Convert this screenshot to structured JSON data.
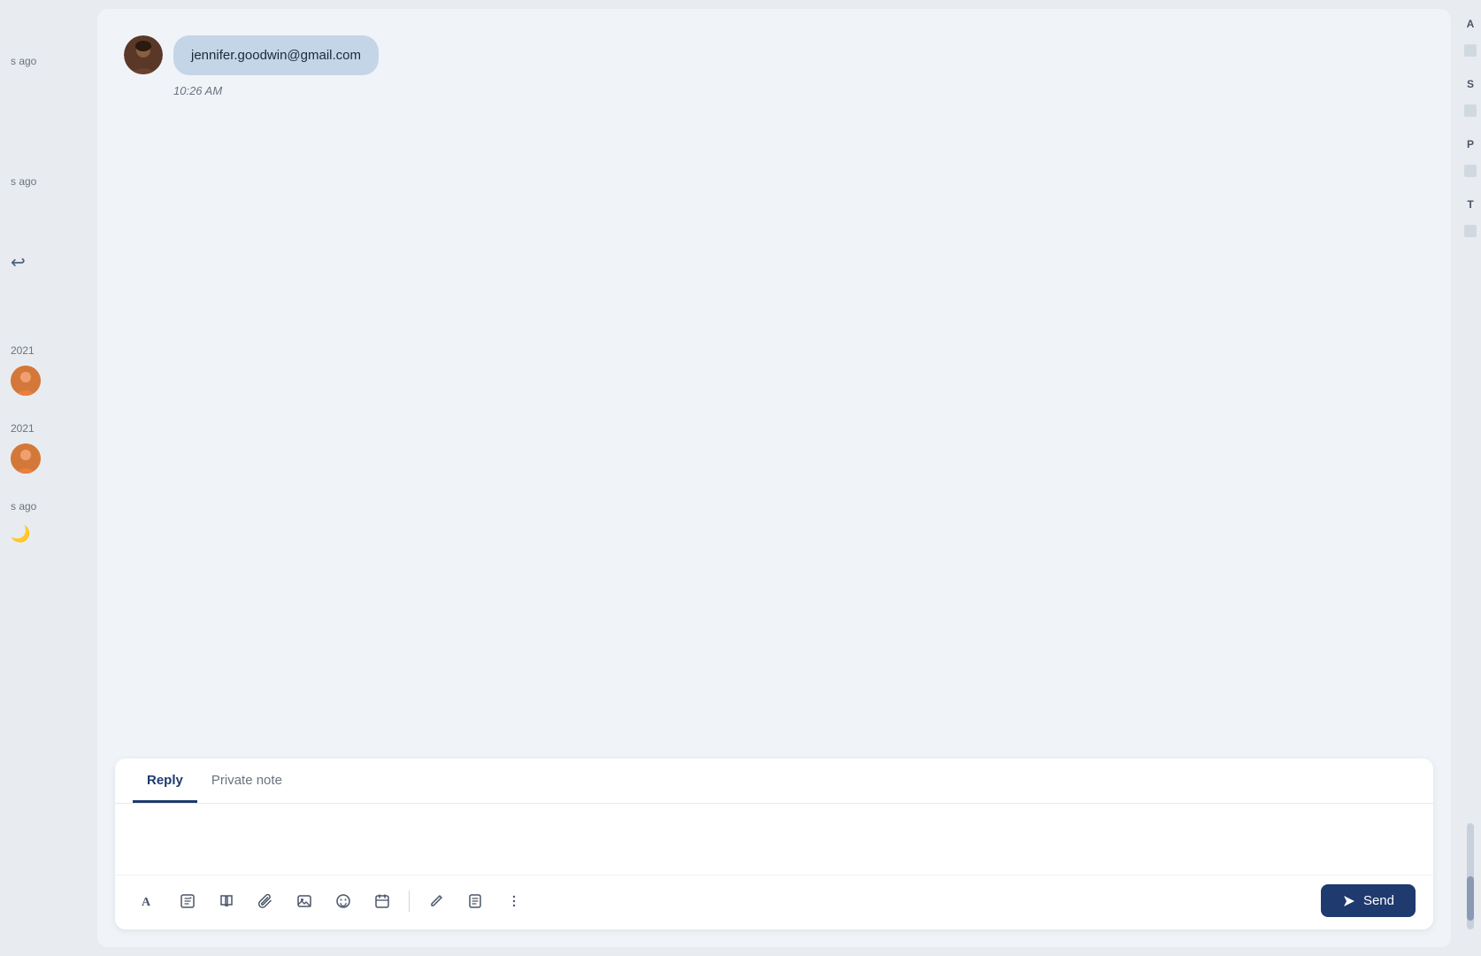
{
  "page": {
    "background_color": "#e8ecf0"
  },
  "left_sidebar": {
    "items": [
      {
        "id": "item1",
        "time": "s ago",
        "has_avatar": false,
        "has_reply_icon": false
      },
      {
        "id": "item2",
        "time": "s ago",
        "has_avatar": false,
        "has_reply_icon": true
      },
      {
        "id": "item3",
        "time": "2021",
        "has_avatar": true,
        "avatar_type": "orange-male"
      },
      {
        "id": "item4",
        "time": "2021",
        "has_avatar": true,
        "avatar_type": "orange-male"
      },
      {
        "id": "item5",
        "time": "s ago",
        "has_avatar": false
      }
    ]
  },
  "message": {
    "sender_email": "jennifer.goodwin@gmail.com",
    "timestamp": "10:26 AM",
    "avatar_alt": "Jennifer Goodwin avatar"
  },
  "compose": {
    "tabs": [
      {
        "id": "reply",
        "label": "Reply",
        "active": true
      },
      {
        "id": "private-note",
        "label": "Private note",
        "active": false
      }
    ],
    "placeholder": "",
    "toolbar_icons": [
      {
        "id": "font",
        "symbol": "A",
        "title": "Font"
      },
      {
        "id": "template",
        "symbol": "⊡",
        "title": "Template"
      },
      {
        "id": "book",
        "symbol": "📖",
        "title": "Knowledge base"
      },
      {
        "id": "attach",
        "symbol": "📎",
        "title": "Attach file"
      },
      {
        "id": "image",
        "symbol": "🖼",
        "title": "Image"
      },
      {
        "id": "emoji",
        "symbol": "😊",
        "title": "Emoji"
      },
      {
        "id": "calendar",
        "symbol": "📅",
        "title": "Calendar"
      },
      {
        "id": "pencil",
        "symbol": "✏️",
        "title": "Edit"
      },
      {
        "id": "note",
        "symbol": "📋",
        "title": "Note"
      },
      {
        "id": "more",
        "symbol": "⋮",
        "title": "More"
      }
    ],
    "send_button_label": "Send"
  },
  "right_panel": {
    "items": [
      "A",
      "S",
      "P",
      "T"
    ]
  }
}
